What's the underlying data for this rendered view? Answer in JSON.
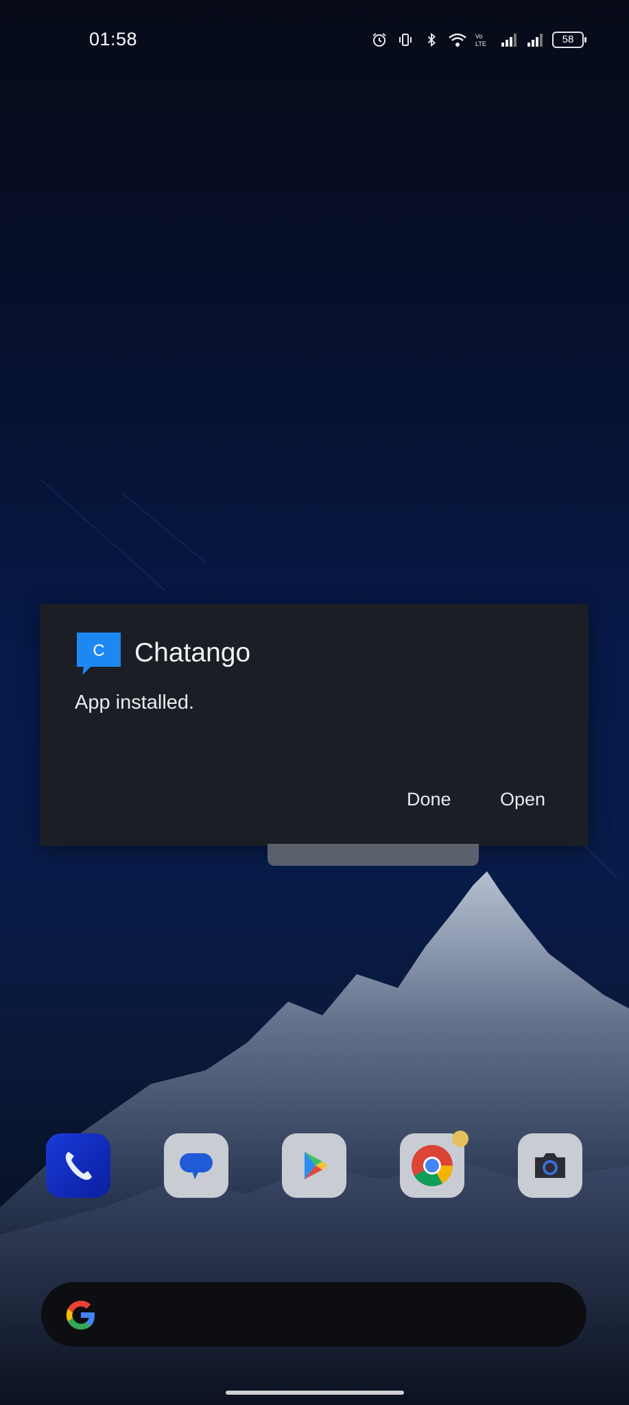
{
  "status_bar": {
    "time": "01:58",
    "battery_level": "58",
    "icons": [
      "alarm-icon",
      "vibrate-icon",
      "bluetooth-icon",
      "wifi-icon",
      "volte-icon",
      "signal-icon",
      "signal-icon-2",
      "battery-icon"
    ]
  },
  "dialog": {
    "app_name": "Chatango",
    "message": "App installed.",
    "done_label": "Done",
    "open_label": "Open",
    "app_icon_letter": "C",
    "app_icon_color": "#1e88f2"
  },
  "dock": {
    "apps": [
      "phone",
      "messages",
      "play-store",
      "chrome",
      "camera"
    ]
  },
  "colors": {
    "dialog_bg": "#1b1e25",
    "wallpaper_top": "#070b18",
    "wallpaper_mid": "#061a4a"
  }
}
